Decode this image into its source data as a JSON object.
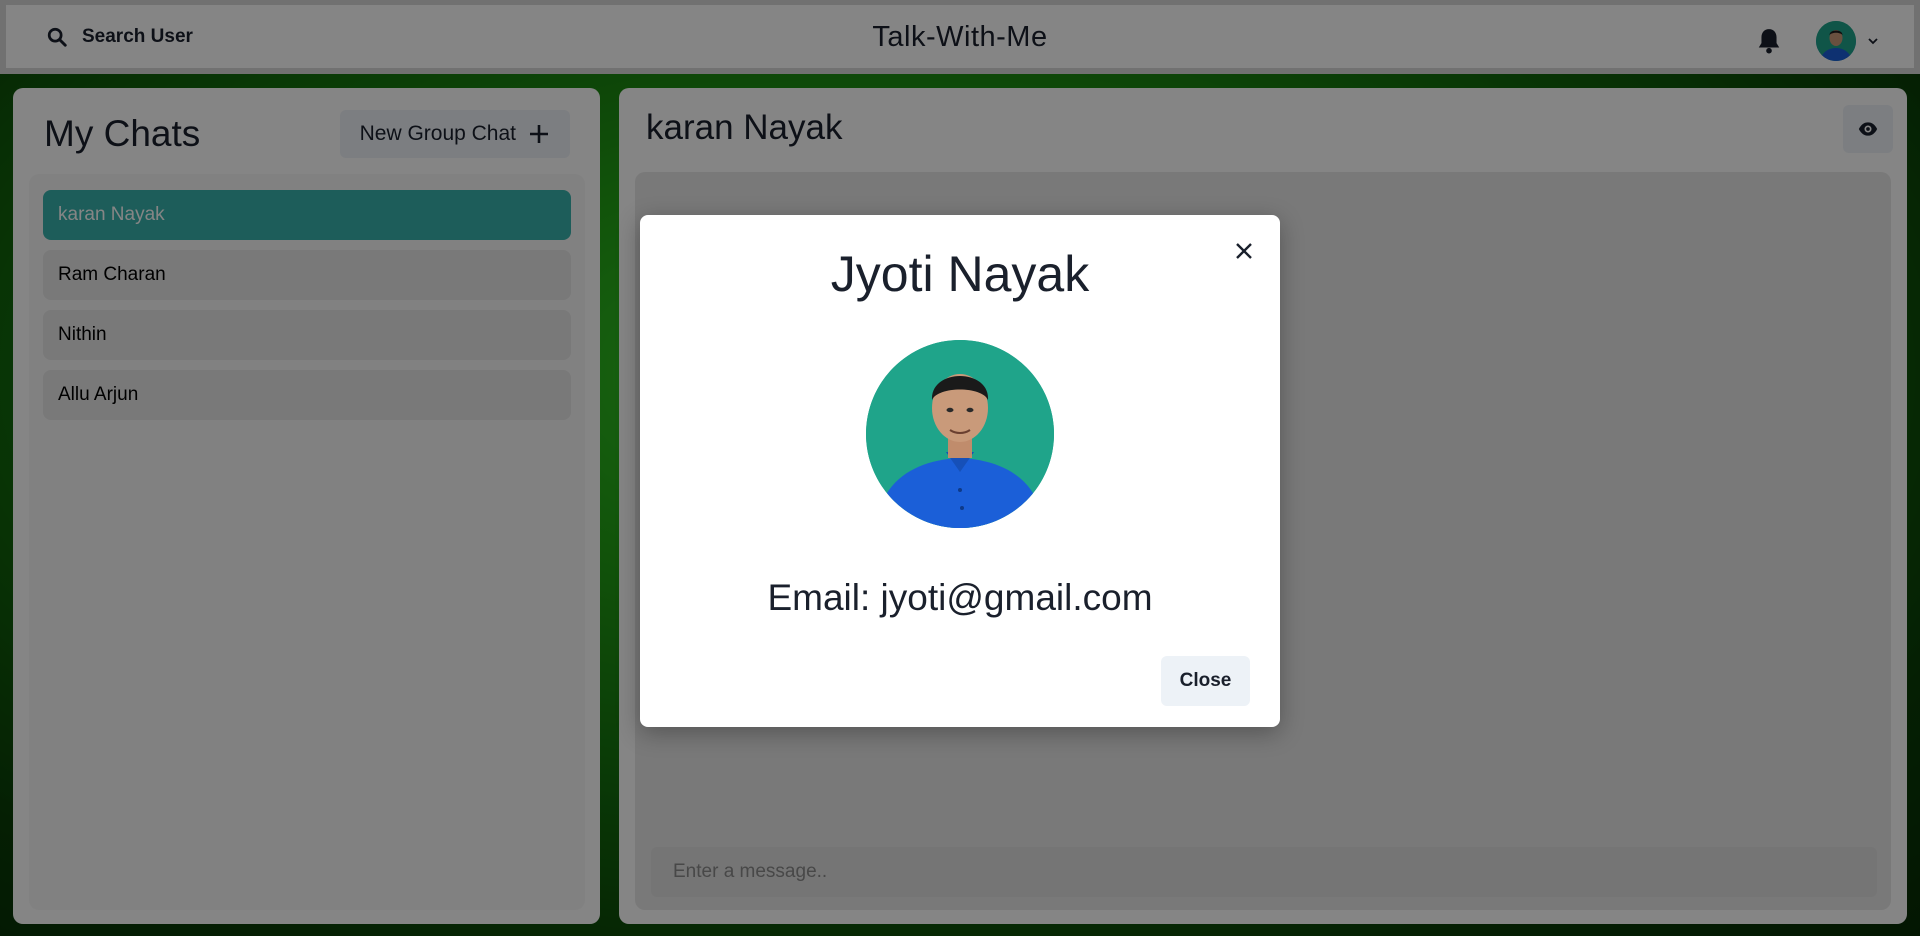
{
  "header": {
    "search_label": "Search User",
    "app_title": "Talk-With-Me"
  },
  "sidebar": {
    "title": "My Chats",
    "new_group_label": "New Group Chat",
    "chats": [
      {
        "name": "karan Nayak",
        "active": true
      },
      {
        "name": "Ram Charan",
        "active": false
      },
      {
        "name": "Nithin",
        "active": false
      },
      {
        "name": "Allu Arjun",
        "active": false
      }
    ]
  },
  "chatbox": {
    "title": "karan Nayak",
    "input_placeholder": "Enter a message.."
  },
  "modal": {
    "title": "Jyoti Nayak",
    "email_text": "Email: jyoti@gmail.com",
    "close_label": "Close"
  },
  "colors": {
    "active_chat": "#38b2ac",
    "button_bg": "#edf2f7",
    "text": "#1a202c"
  }
}
